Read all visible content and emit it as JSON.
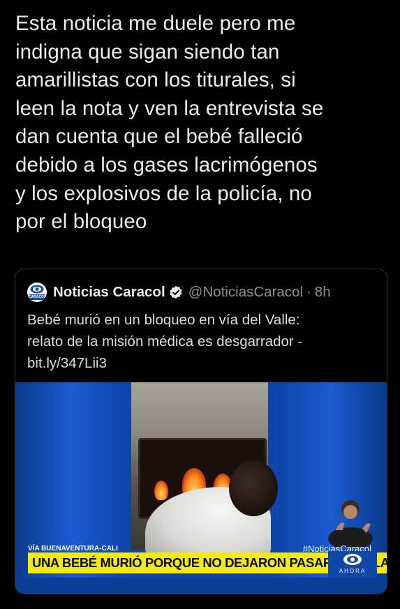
{
  "tweet": {
    "text": "Esta noticia me duele pero me\nindigna que sigan siendo tan\namarillistas con los titurales, si\nleen la nota y ven la entrevista se\ndan cuenta que el bebé falleció\ndebido a los gases lacrimógenos\ny los explosivos de la policía, no\npor el bloqueo"
  },
  "quoted_tweet": {
    "display_name": "Noticias Caracol",
    "handle": "@NoticiasCaracol",
    "separator": "·",
    "time": "8h",
    "text": "Bebé murió en un bloqueo en vía del Valle:\nrelato de la misión médica es desgarrador -\nbit.ly/347Lii3",
    "avatar_label": "CARACOL",
    "verified_icon": "verified-badge-icon"
  },
  "media": {
    "location": "VÍA BUENAVENTURA-CALI",
    "hashtag": "#NoticiasCaracol",
    "headline": "UNA BEBÉ MURIÓ PORQUE NO DEJARON PASAR AMBULANCIA",
    "badge_text": "AHORA",
    "colors": {
      "headline_bg": "#f3ea12",
      "brand_blue": "#0f47a8"
    }
  }
}
